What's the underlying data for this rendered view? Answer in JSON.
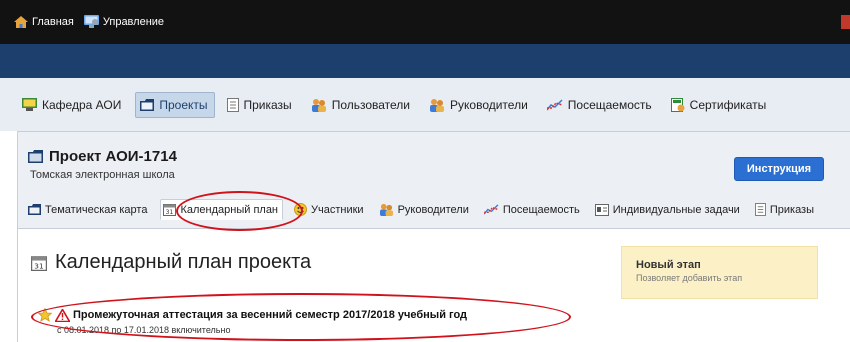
{
  "topnav": {
    "home_label": "Главная",
    "admin_label": "Управление"
  },
  "mainnav": {
    "items": [
      {
        "label": "Кафедра АОИ",
        "icon": "monitor-icon"
      },
      {
        "label": "Проекты",
        "icon": "folder-icon",
        "active": true
      },
      {
        "label": "Приказы",
        "icon": "document-icon"
      },
      {
        "label": "Пользователи",
        "icon": "users-icon"
      },
      {
        "label": "Руководители",
        "icon": "users-icon"
      },
      {
        "label": "Посещаемость",
        "icon": "chart-line-icon"
      },
      {
        "label": "Сертификаты",
        "icon": "certificate-icon"
      }
    ]
  },
  "project": {
    "title": "Проект АОИ-1714",
    "subtitle": "Томская электронная школа",
    "instruction_label": "Инструкция",
    "tabs": [
      {
        "label": "Тематическая карта",
        "icon": "folder-icon"
      },
      {
        "label": "Календарный план",
        "icon": "calendar-icon",
        "active": true
      },
      {
        "label": "Участники",
        "icon": "smiley-icon"
      },
      {
        "label": "Руководители",
        "icon": "users-icon"
      },
      {
        "label": "Посещаемость",
        "icon": "chart-line-icon"
      },
      {
        "label": "Индивидуальные задачи",
        "icon": "task-icon"
      },
      {
        "label": "Приказы",
        "icon": "document-icon"
      }
    ]
  },
  "content": {
    "title": "Календарный план проекта",
    "new_stage": {
      "title": "Новый этап",
      "subtitle": "Позволяет добавить этап"
    },
    "stage": {
      "title": "Промежуточная аттестация за весенний семестр 2017/2018 учебный год",
      "dates": "с 08.01.2018 по 17.01.2018 включительно"
    }
  },
  "colors": {
    "topbar": "#121212",
    "bluebar": "#1d3f6e",
    "nav_bg": "#e8ecf3",
    "button": "#2c6fd2",
    "notice_bg": "#fbf0c6",
    "highlight_oval": "#d0121b"
  }
}
